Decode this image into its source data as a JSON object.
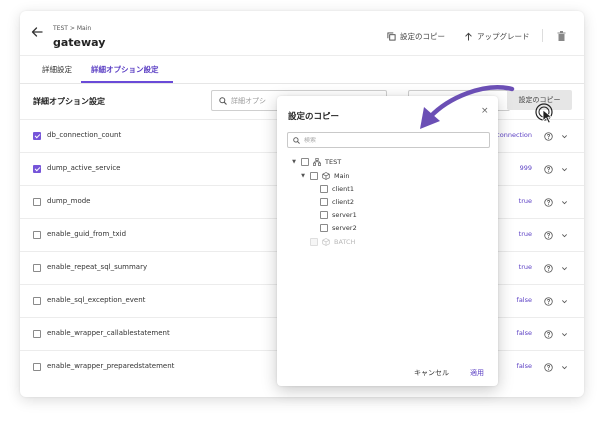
{
  "header": {
    "breadcrumb_parent": "TEST",
    "breadcrumb_separator": ">",
    "breadcrumb_current": "Main",
    "title": "gateway",
    "copy_settings_label": "設定のコピー",
    "upgrade_label": "アップグレード"
  },
  "tabs": [
    {
      "label": "詳細設定",
      "active": false
    },
    {
      "label": "詳細オプション設定",
      "active": true
    }
  ],
  "section": {
    "title": "詳細オプション設定",
    "search_placeholder": "詳細オプシ",
    "copy_button_label": "設定のコピー"
  },
  "rows": [
    {
      "name": "db_connection_count",
      "value": "connection",
      "checked": true
    },
    {
      "name": "dump_active_service",
      "value": "999",
      "checked": true
    },
    {
      "name": "dump_mode",
      "value": "true",
      "checked": false
    },
    {
      "name": "enable_guid_from_txid",
      "value": "true",
      "checked": false
    },
    {
      "name": "enable_repeat_sql_summary",
      "value": "true",
      "checked": false
    },
    {
      "name": "enable_sql_exception_event",
      "value": "false",
      "checked": false
    },
    {
      "name": "enable_wrapper_callablestatement",
      "value": "false",
      "checked": false
    },
    {
      "name": "enable_wrapper_preparedstatement",
      "value": "false",
      "checked": false
    }
  ],
  "modal": {
    "title": "設定のコピー",
    "close_label": "×",
    "search_placeholder": "検索",
    "tree": [
      {
        "label": "TEST",
        "level": 0,
        "icon": "project-icon",
        "caret": "▼",
        "disabled": false
      },
      {
        "label": "Main",
        "level": 1,
        "icon": "cube-icon",
        "caret": "▼",
        "disabled": false
      },
      {
        "label": "client1",
        "level": 2,
        "icon": "",
        "caret": "",
        "disabled": false
      },
      {
        "label": "client2",
        "level": 2,
        "icon": "",
        "caret": "",
        "disabled": false
      },
      {
        "label": "server1",
        "level": 2,
        "icon": "",
        "caret": "",
        "disabled": false
      },
      {
        "label": "server2",
        "level": 2,
        "icon": "",
        "caret": "",
        "disabled": false
      },
      {
        "label": "BATCH",
        "level": 1,
        "icon": "cube-icon",
        "caret": "",
        "disabled": true
      }
    ],
    "cancel_label": "キャンセル",
    "apply_label": "適用"
  },
  "colors": {
    "accent": "#5b3fc4",
    "checkbox_checked": "#7655d9",
    "arrow": "#6b4fb5"
  }
}
